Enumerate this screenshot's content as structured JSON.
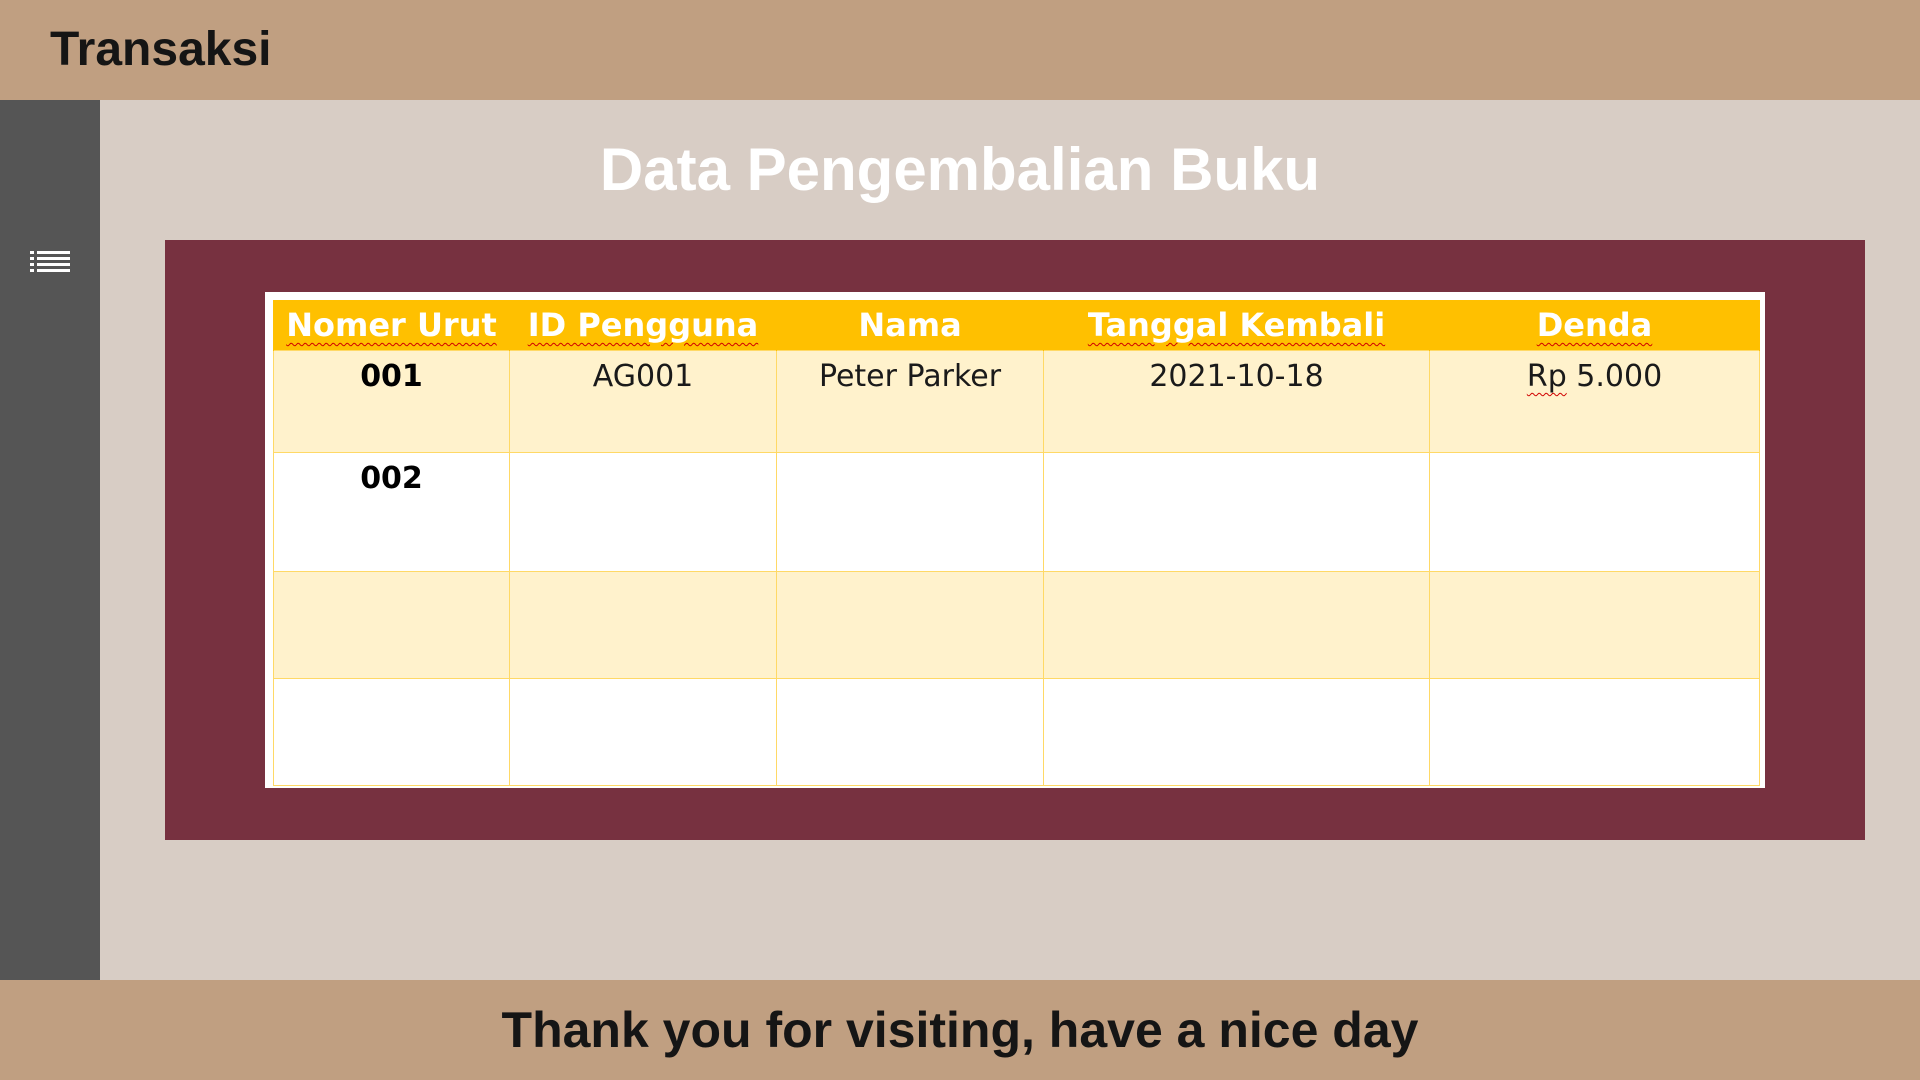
{
  "header": {
    "title": "Transaksi"
  },
  "sidebar": {
    "menu_icon": "list-icon"
  },
  "main": {
    "page_title": "Data Pengembalian Buku",
    "table": {
      "columns": [
        "Nomer Urut",
        "ID Pengguna",
        "Nama",
        "Tanggal Kembali",
        "Denda"
      ],
      "rows": [
        [
          "001",
          "AG001",
          "Peter Parker",
          "2021-10-18",
          "Rp 5.000"
        ],
        [
          "002",
          "",
          "",
          "",
          ""
        ],
        [
          "",
          "",
          "",
          "",
          ""
        ],
        [
          "",
          "",
          "",
          "",
          ""
        ]
      ]
    }
  },
  "footer": {
    "message": "Thank you for visiting, have a nice day"
  },
  "colors": {
    "header_bg": "#c09f81",
    "sidebar_bg": "#555555",
    "main_bg": "#d8cdc5",
    "panel_bg": "#773140",
    "table_header_bg": "#ffc000",
    "table_row_alt_bg": "#fff2cc"
  }
}
